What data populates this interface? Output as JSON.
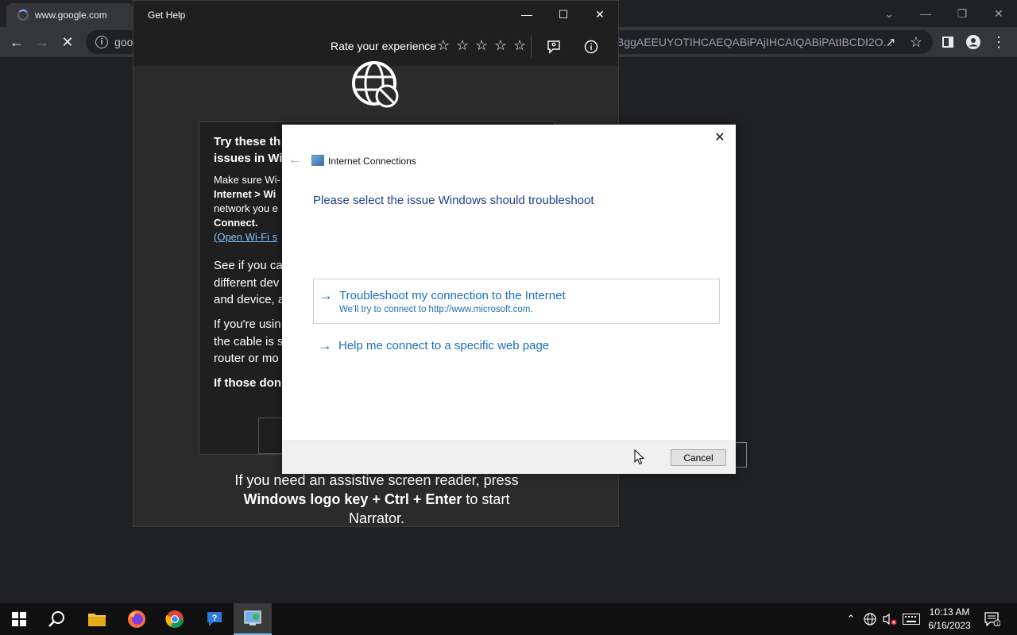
{
  "browser": {
    "tab_title": "www.google.com",
    "url_visible": "goo",
    "url_tail": "BggAEEUYOTIHCAEQABiPAjIHCAIQABiPAtIBCDI2O..."
  },
  "get_help": {
    "window_title": "Get Help",
    "rate_label": "Rate your experience",
    "card_heading": "Try these th\nissues in Wi",
    "p1_prefix": "Make sure Wi-",
    "p1_bold1": "Internet > Wi",
    "p1_line3": "network you e",
    "p1_bold2": "Connect.",
    "p1_link": "(Open Wi-Fi s",
    "p2": "See if you ca\ndifferent dev\nand device, a",
    "p3": "If you're usin\nthe cable is s\nrouter or mo",
    "p4": "If those don",
    "footer_pre": "If you need an assistive screen reader, press",
    "footer_bold": "Windows logo key + Ctrl + Enter",
    "footer_post": " to start",
    "footer_last": "Narrator."
  },
  "dialog": {
    "app_title": "Internet Connections",
    "heading": "Please select the issue Windows should troubleshoot",
    "options": [
      {
        "title": "Troubleshoot my connection to the Internet",
        "subtitle": "We'll try to connect to http://www.microsoft.com."
      },
      {
        "title": "Help me connect to a specific web page"
      }
    ],
    "cancel_label": "Cancel"
  },
  "taskbar": {
    "time": "10:13 AM",
    "date": "6/16/2023",
    "notification_count": "1"
  }
}
